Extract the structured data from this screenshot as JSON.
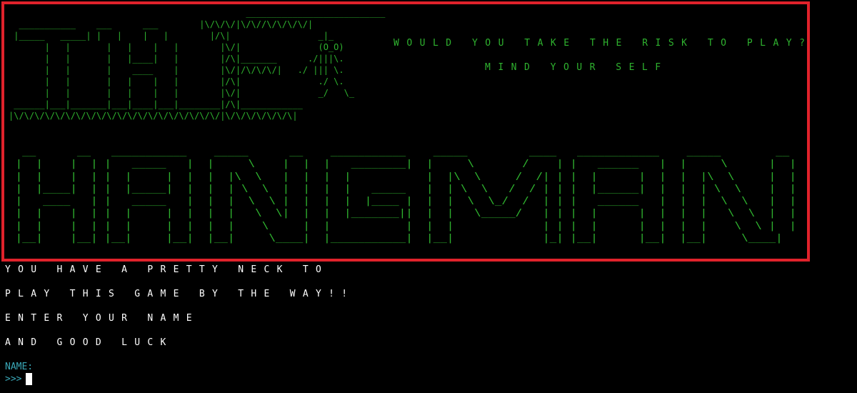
{
  "banner": {
    "the_art": "                                              ___________________________\n  ___________    ___      ___        |\\/\\/\\/|\\/\\//\\/\\/\\/\\/|\n |_____   _____| |   |    |   |        |/\\|                 _|_\n       |   |       |   |    |   |        |\\/|               (O_O)\n       |   |       |   |____|   |        |/\\|_______      ./|||\\.\n       |   |       |    ____    |        |\\/|/\\/\\/\\/|   ./ ||| \\.\n       |   |       |   |    |   |        |/\\|               ./ \\.\n       |   |       |   |    |   |        |\\/|               _/   \\_\n ______|___|_______|___|____|___|________|/\\|____________\n|\\/\\/\\/\\/\\/\\/\\/\\/\\/\\/\\/\\/\\/\\/\\/\\/\\/\\/\\/\\/|\\/\\/\\/\\/\\/\\/\\|",
    "hangman_art": "  __      __   ___________    _____      __    ___________    _____         ____   ____________    _____        __\n |  |    |  | |   _____   |  |     \\    |  |  |   ________|  |     \\       /    | |   ______   |  |     \\      |  |\n |  |    |  | |  |     |  |  |  |\\  \\   |  |  |  |           |  |\\  \\     /  /| | |  |      |  |  |  |\\  \\     |  |\n |  |____|  | |  |_____|  |  |  | \\  \\  |  |  |  |   _____   |  | \\  \\   /  / | | |  |______|  |  |  | \\  \\    |  |\n |   ____   | |   _____   |  |  |  \\  \\ |  |  |  |  |____ |  |  |  \\  \\_/  /  | | |   ______   |  |  |  \\  \\   |  |\n |  |    |  | |  |     |  |  |  |   \\  \\|  |  |  |_______||  |  |   \\_____/   | | |  |      |  |  |  |   \\  \\  |  |\n |  |    |  | |  |     |  |  |  |    \\     |  |           |  |  |             | | |  |      |  |  |  |    \\  \\ |  |\n |__|    |__| |__|     |__|  |__|     \\____|  |___________|  |__|             |_| |__|      |__|  |__|     \\____|",
    "tagline_1": "WOULD YOU TAKE THE RISK TO PLAY?",
    "tagline_2": "MIND YOUR SELF"
  },
  "messages": [
    "YOU HAVE A PRETTY NECK TO",
    "PLAY THIS GAME BY THE WAY!!",
    "ENTER YOUR NAME",
    "AND GOOD LUCK"
  ],
  "prompt": {
    "label": "NAME:",
    "arrows": ">>>",
    "value": ""
  },
  "colors": {
    "art_green": "#2fb32f",
    "frame_red": "#e0222b",
    "prompt_cyan": "#3aa8b8",
    "text_white": "#ffffff",
    "background": "#000000"
  }
}
